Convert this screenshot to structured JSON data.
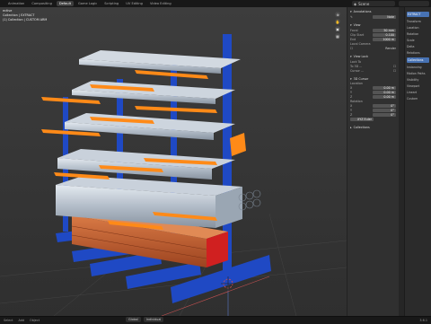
{
  "topbar": {
    "tabs": [
      "Animation",
      "Compositing",
      "Default",
      "Game Logic",
      "Scripting",
      "UV Editing",
      "Video Editing"
    ],
    "active_tab": "Default",
    "scene_label": "Scene"
  },
  "viewport": {
    "overlay_lines": [
      "ective",
      "Collection | EXTRACT",
      "(1) Collection | CUSTOM ARM"
    ],
    "gizmo_icons": [
      "zoom-icon",
      "hand-icon",
      "camera-icon",
      "grid-icon"
    ]
  },
  "npanel": {
    "annotations": {
      "title": "Annotations",
      "value": "Note"
    },
    "view": {
      "title": "View",
      "rows": [
        {
          "label": "Focal",
          "value": "50 mm"
        },
        {
          "label": "Clip Start",
          "value": "0.100"
        },
        {
          "label": "End",
          "value": "1000 m"
        }
      ],
      "local_cam": "Local Camera",
      "render": "Render"
    },
    "view_lock": {
      "title": "View Lock",
      "lock_to": "Lock To",
      "lock_obj": "To 3D ...",
      "cursor": "Cursor ..."
    },
    "cursor_3d": {
      "title": "3D Cursor",
      "location": "Location",
      "rows": [
        {
          "label": "X",
          "value": "0.00 m"
        },
        {
          "label": "Y",
          "value": "0.00 m"
        },
        {
          "label": "Z",
          "value": "0.00 m"
        }
      ],
      "rotation": "Rotation",
      "rot_rows": [
        {
          "label": "X",
          "value": "0°"
        },
        {
          "label": "Y",
          "value": "0°"
        },
        {
          "label": "Z",
          "value": "0°"
        }
      ],
      "mode": "XYZ Euler"
    },
    "collections": {
      "title": "Collections"
    }
  },
  "props": {
    "rows": [
      "EXTRACT",
      "Transform",
      "Location",
      "Rotation",
      "Scale",
      "Delta",
      "Relations",
      "Collections",
      "Instancing",
      "Motion Paths",
      "Visibility",
      "Viewport",
      "Lineart",
      "Custom"
    ]
  },
  "statusbar": {
    "left": [
      "Select",
      "Add",
      "Object"
    ],
    "tools": [
      "Global",
      "Individual"
    ],
    "version": "3.6.1"
  },
  "colors": {
    "steel_blue": "#1f49c4",
    "arm_orange": "#ff8a18",
    "pipe_gray": "#b9c3cf",
    "wood": "#c25a2a",
    "accent": "#4772b3"
  }
}
